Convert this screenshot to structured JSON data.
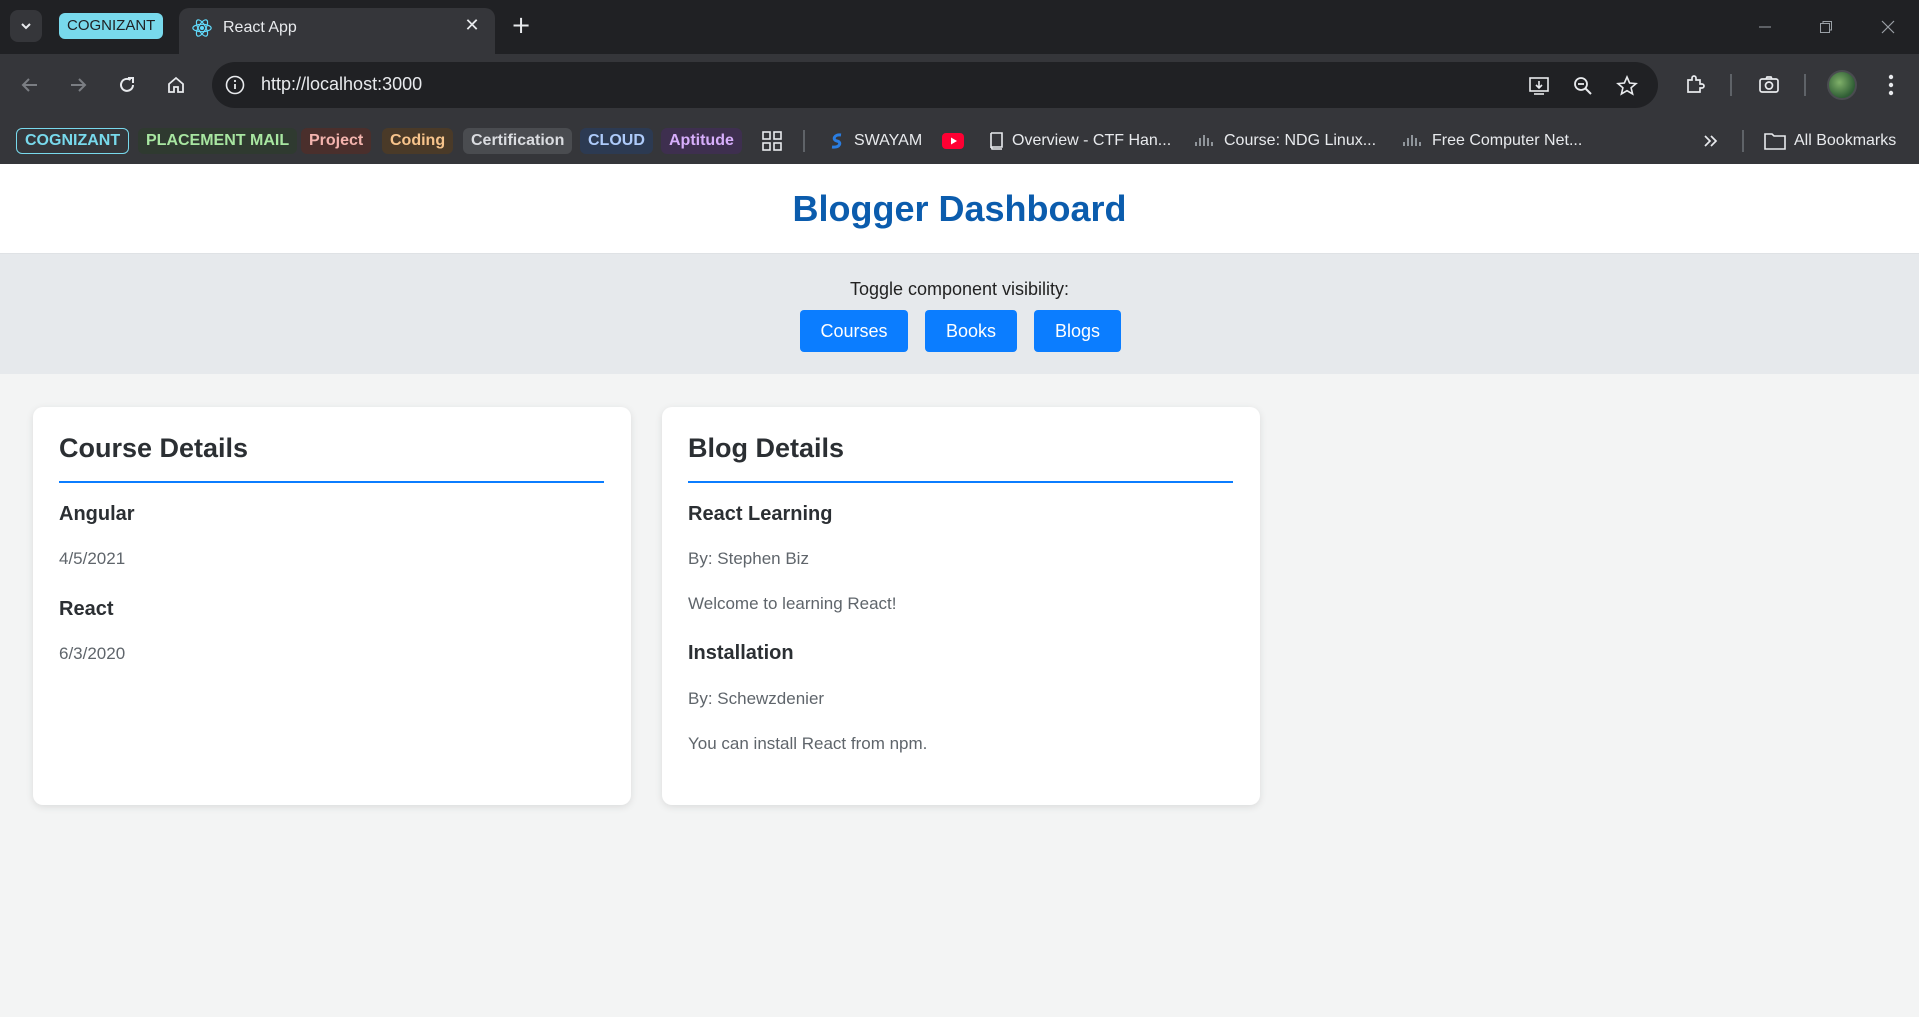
{
  "browser": {
    "tab_group_label": "COGNIZANT",
    "tab_title": "React App",
    "url": "http://localhost:3000",
    "bookmarks_chips": [
      {
        "label": "COGNIZANT",
        "color": "#78d9ec",
        "bg": "#202124"
      },
      {
        "label": "PLACEMENT MAIL",
        "color": "#a8e6a1",
        "bg": "#2f3a30"
      },
      {
        "label": "Project",
        "color": "#f4b4ae",
        "bg": "#4a2f2c"
      },
      {
        "label": "Coding",
        "color": "#f7c48c",
        "bg": "#4a3a28"
      },
      {
        "label": "Certification",
        "color": "#dadce0",
        "bg": "#4a4c50"
      },
      {
        "label": "CLOUD",
        "color": "#aecbfa",
        "bg": "#2c3a52"
      },
      {
        "label": "Aptitude",
        "color": "#d7aefb",
        "bg": "#3e2f4f"
      }
    ],
    "bookmarks_links": [
      "SWAYAM",
      "Overview - CTF Han...",
      "Course: NDG Linux...",
      "Free Computer Net..."
    ],
    "all_bookmarks": "All Bookmarks"
  },
  "app": {
    "title": "Blogger Dashboard",
    "toggle_label": "Toggle component visibility:",
    "buttons": [
      "Courses",
      "Books",
      "Blogs"
    ],
    "accent": "#0b7dff"
  },
  "courses": {
    "heading": "Course Details",
    "items": [
      {
        "name": "Angular",
        "date": "4/5/2021"
      },
      {
        "name": "React",
        "date": "6/3/2020"
      }
    ]
  },
  "blogs": {
    "heading": "Blog Details",
    "items": [
      {
        "title": "React Learning",
        "author": "By: Stephen Biz",
        "body": "Welcome to learning React!"
      },
      {
        "title": "Installation",
        "author": "By: Schewzdenier",
        "body": "You can install React from npm."
      }
    ]
  }
}
